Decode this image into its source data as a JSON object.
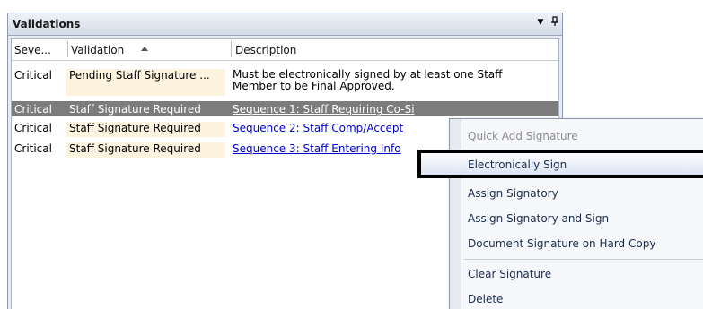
{
  "panel": {
    "title": "Validations",
    "dropdown_icon": "▼",
    "pin_icon": "ᵖ"
  },
  "columns": {
    "severity": "Seve...",
    "validation": "Validation",
    "description": "Description"
  },
  "rows": [
    {
      "severity": "Critical",
      "validation": "Pending Staff Signature ...",
      "description": "Must be electronically signed by at least one Staff Member to be Final Approved.",
      "link": false
    },
    {
      "severity": "Critical",
      "validation": "Staff Signature Required",
      "description": "Sequence 1: Staff Requiring Co-Si",
      "link": true,
      "selected": true
    },
    {
      "severity": "Critical",
      "validation": "Staff Signature Required",
      "description": "Sequence 2: Staff Comp/Accept",
      "link": true
    },
    {
      "severity": "Critical",
      "validation": "Staff Signature Required",
      "description": "Sequence 3: Staff Entering Info",
      "link": true
    }
  ],
  "menu": {
    "quick_add": "Quick Add Signature",
    "electronically_sign": "Electronically Sign",
    "assign_signatory": "Assign Signatory",
    "assign_and_sign": "Assign Signatory and Sign",
    "document_hard_copy": "Document Signature on Hard Copy",
    "clear_signature": "Clear Signature",
    "delete": "Delete"
  }
}
